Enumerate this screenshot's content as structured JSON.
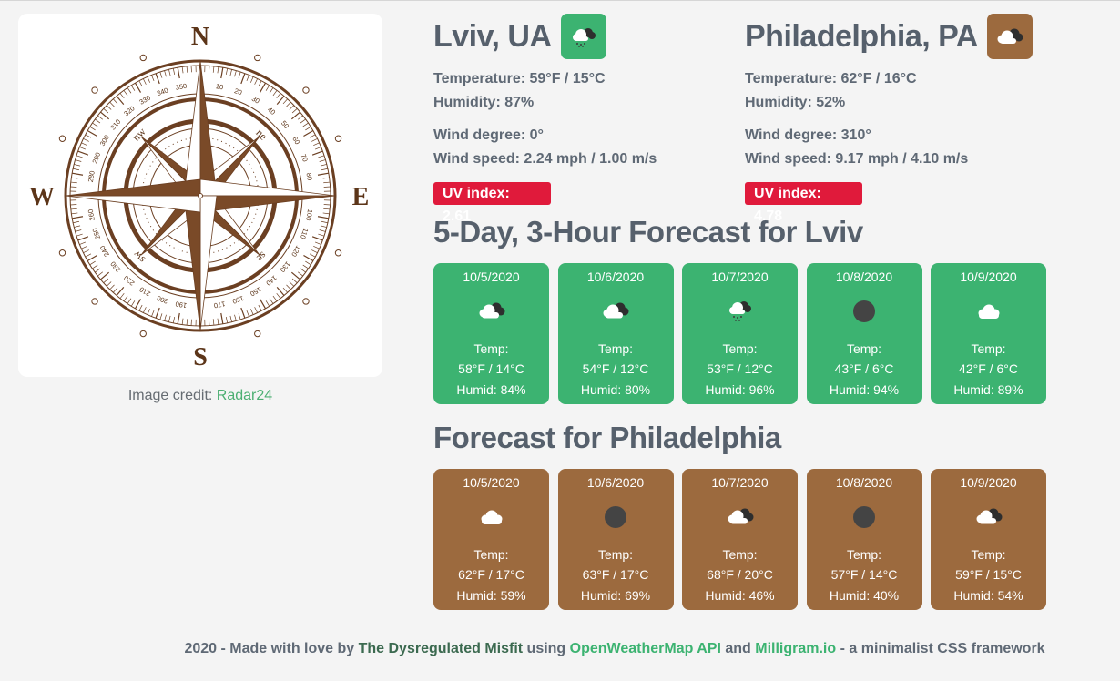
{
  "credit": {
    "prefix": "Image credit: ",
    "link": "Radar24"
  },
  "compass": {
    "letters": {
      "n": "N",
      "s": "S",
      "e": "E",
      "w": "W"
    },
    "inter": {
      "nw": "nw",
      "ne": "ne",
      "sw": "sw",
      "se": "se"
    },
    "degree_labels": [
      "10",
      "20",
      "30",
      "40",
      "50",
      "60",
      "70",
      "80",
      "100",
      "110",
      "120",
      "130",
      "140",
      "150",
      "160",
      "170",
      "190",
      "200",
      "210",
      "220",
      "230",
      "240",
      "250",
      "260",
      "280",
      "290",
      "300",
      "310",
      "320",
      "330",
      "340",
      "350"
    ],
    "colors": {
      "ink": "#6b3f22",
      "fill": "#7a4a28"
    }
  },
  "cities": [
    {
      "name": "Lviv, UA",
      "icon": "rain-cloud-icon",
      "temperature": "Temperature: 59°F / 15°C",
      "humidity": "Humidity: 87%",
      "wind_degree": "Wind degree: 0°",
      "wind_speed": "Wind speed: 2.24 mph / 1.00 m/s",
      "uv": "UV index: 2.61"
    },
    {
      "name": "Philadelphia, PA",
      "icon": "broken-clouds-icon",
      "temperature": "Temperature: 62°F / 16°C",
      "humidity": "Humidity: 52%",
      "wind_degree": "Wind degree: 310°",
      "wind_speed": "Wind speed: 9.17 mph / 4.10 m/s",
      "uv": "UV index: 4.78"
    }
  ],
  "forecast_titles": [
    "5-Day, 3-Hour Forecast for Lviv",
    "Forecast for Philadelphia"
  ],
  "forecast_lviv": [
    {
      "date": "10/5/2020",
      "icon": "broken-clouds-icon",
      "label": "Temp:",
      "temp": "58°F / 14°C",
      "humid": "Humid: 84%"
    },
    {
      "date": "10/6/2020",
      "icon": "broken-clouds-icon",
      "label": "Temp:",
      "temp": "54°F / 12°C",
      "humid": "Humid: 80%"
    },
    {
      "date": "10/7/2020",
      "icon": "rain-cloud-icon",
      "label": "Temp:",
      "temp": "53°F / 12°C",
      "humid": "Humid: 96%"
    },
    {
      "date": "10/8/2020",
      "icon": "dark-circle-icon",
      "label": "Temp:",
      "temp": "43°F / 6°C",
      "humid": "Humid: 94%"
    },
    {
      "date": "10/9/2020",
      "icon": "cloud-icon",
      "label": "Temp:",
      "temp": "42°F / 6°C",
      "humid": "Humid: 89%"
    }
  ],
  "forecast_phila": [
    {
      "date": "10/5/2020",
      "icon": "cloud-icon",
      "label": "Temp:",
      "temp": "62°F / 17°C",
      "humid": "Humid: 59%"
    },
    {
      "date": "10/6/2020",
      "icon": "dark-circle-icon",
      "label": "Temp:",
      "temp": "63°F / 17°C",
      "humid": "Humid: 69%"
    },
    {
      "date": "10/7/2020",
      "icon": "broken-clouds-icon",
      "label": "Temp:",
      "temp": "68°F / 20°C",
      "humid": "Humid: 46%"
    },
    {
      "date": "10/8/2020",
      "icon": "dark-circle-icon",
      "label": "Temp:",
      "temp": "57°F / 14°C",
      "humid": "Humid: 40%"
    },
    {
      "date": "10/9/2020",
      "icon": "broken-clouds-icon",
      "label": "Temp:",
      "temp": "59°F / 15°C",
      "humid": "Humid: 54%"
    }
  ],
  "footer": {
    "prefix": "2020 - Made with love by ",
    "author": "The Dysregulated Misfit",
    "using": " using ",
    "api": "OpenWeatherMap API",
    "and": " and ",
    "framework": "Milligram.io",
    "suffix": " - a minimalist CSS framework"
  },
  "colors": {
    "green": "#3cb371",
    "brown": "#9c6a3e",
    "uv": "#e01a3b"
  }
}
